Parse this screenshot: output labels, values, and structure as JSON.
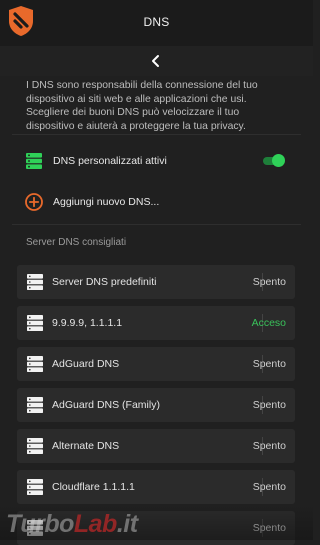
{
  "header": {
    "title": "DNS",
    "logo_icon": "blokada-shield-logo",
    "accent_color": "#e8692b"
  },
  "nav": {
    "back_icon": "chevron-left-icon"
  },
  "intro": {
    "text": "I DNS sono responsabili della connessione del tuo dispositivo ai siti web e alle applicazioni che usi. Scegliere dei buoni DNS può velocizzare il tuo dispositivo e aiuterà a proteggere la tua privacy."
  },
  "custom_dns": {
    "label": "DNS personalizzati attivi",
    "enabled": true,
    "icon": "server-stack-icon"
  },
  "add_dns": {
    "label": "Aggiungi nuovo DNS...",
    "icon": "plus-circle-icon"
  },
  "servers_section": {
    "label": "Server DNS consigliati"
  },
  "servers": [
    {
      "name": "Server DNS predefiniti",
      "status": "Spento",
      "active": false
    },
    {
      "name": "9.9.9.9, 1.1.1.1",
      "status": "Acceso",
      "active": true
    },
    {
      "name": "AdGuard DNS",
      "status": "Spento",
      "active": false
    },
    {
      "name": "AdGuard DNS (Family)",
      "status": "Spento",
      "active": false
    },
    {
      "name": "Alternate DNS",
      "status": "Spento",
      "active": false
    },
    {
      "name": "Cloudflare 1.1.1.1",
      "status": "Spento",
      "active": false
    },
    {
      "name": "",
      "status": "Spento",
      "active": false
    }
  ],
  "colors": {
    "active_green": "#39c25a",
    "toggle_green": "#2fd158",
    "icon_orange": "#e8692b"
  },
  "watermark": {
    "part1": "Turbo",
    "part2": "Lab",
    "part3": ".it"
  }
}
